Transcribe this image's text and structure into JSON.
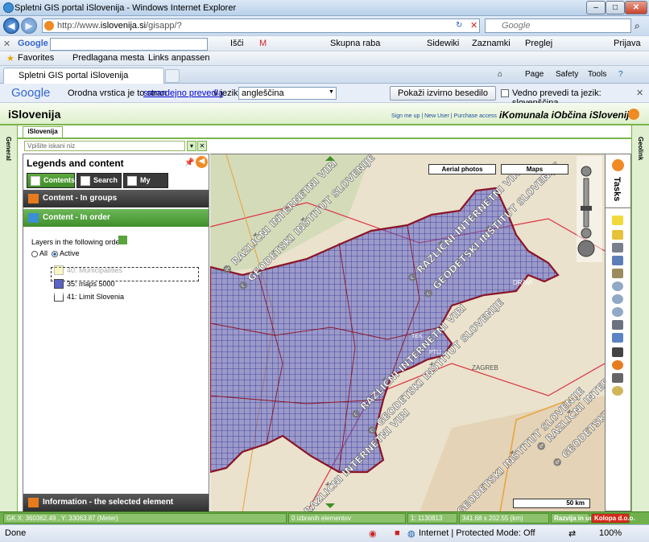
{
  "window": {
    "title": "Spletni GIS portal iSlovenija - Windows Internet Explorer",
    "url_prefix": "http://www.",
    "url_domain": "islovenija.si",
    "url_path": "/gisapp/?",
    "search_placeholder": "Google"
  },
  "google_toolbar": {
    "logo": "Google",
    "items": [
      "Išči",
      "M",
      "Skupna raba",
      "Sidewiki",
      "Zaznamki",
      "Preglej",
      "Prijava"
    ]
  },
  "favorites": {
    "label": "Favorites",
    "items": [
      "Predlagana mesta",
      "Links anpassen"
    ]
  },
  "tabs": {
    "active": "Spletni GIS portal iSlovenija",
    "commands": [
      "Page",
      "Safety",
      "Tools"
    ]
  },
  "translate": {
    "logo": "Google",
    "prefix": "Orodna vrstica je to stran",
    "link": "samodejno prevedla",
    "middle": "v jezik:",
    "language": "angleščina",
    "show_original": "Pokaži izvirno besedilo",
    "never_translate": "Vedno prevedi ta jezik: slovenščina"
  },
  "app": {
    "brand": "iSlovenija",
    "links": "Sign me up | New User | Purchase access",
    "logos": "iKomunala iObčina iSlovenija",
    "left_strip": "General",
    "right_strip": "Geolink",
    "app_tab": "iSlovenija",
    "search_placeholder": "Vpišite iskani niz"
  },
  "legend": {
    "title": "Legends and content",
    "tabs": [
      "Contents",
      "Search",
      "My Data"
    ],
    "bar_groups": "Content - In groups",
    "bar_order": "Content - In order",
    "order_label": "Layers in the following order:",
    "radio_all": "All",
    "radio_active": "Active",
    "layers": [
      {
        "label": "40: Municipalities",
        "color": "#f2e84c"
      },
      {
        "label": "35: maps 5000",
        "color": "#5a63c9"
      },
      {
        "label": "41: Limit Slovenia",
        "color": "#b21c1c"
      }
    ],
    "info_bar": "Information - the selected element"
  },
  "map": {
    "btn_aerial": "Aerial photos",
    "btn_maps": "Maps",
    "scale_label": "50 km",
    "watermark_a": "© RAZLIČNI INTERNETNI VIRI",
    "watermark_b": "© GEODETSKI INŠTITUT SLOVENIJE",
    "place_labels": [
      "DRAVI",
      "ZAGREB",
      "TEK",
      "PTLI"
    ],
    "grid_color": "#3a3fb8",
    "border_color": "#8b1428"
  },
  "tasks": {
    "label": "Tasks"
  },
  "app_status": {
    "coords": "GK X: 360362.49 , Y: 33063.87 (Meter)",
    "selected": "0 izbranih elementov",
    "scale": "1: 1130813",
    "extent": "341.68 x 202.55 (km)",
    "dev": "Razvija in ureja",
    "company": "Kolopa d.o.o."
  },
  "ie_status": {
    "left": "Done",
    "zone": "Internet | Protected Mode: Off",
    "zoom": "100%"
  }
}
